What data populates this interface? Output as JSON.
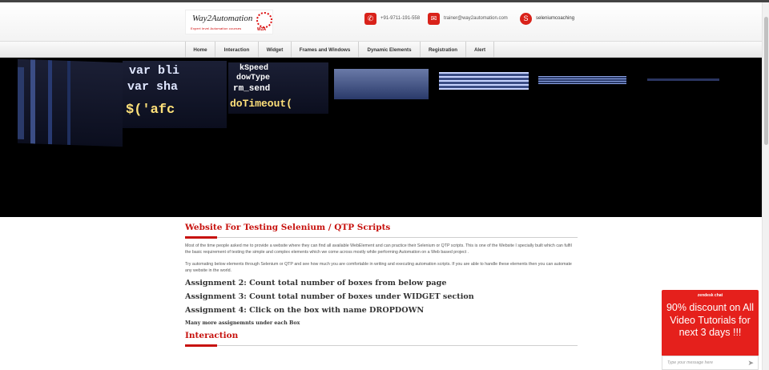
{
  "logo": {
    "name": "Way2Automation",
    "tagline": "Expert level Automation courses",
    "mark": "W2A"
  },
  "contacts": [
    {
      "icon": "phone-icon",
      "glyph": "✆",
      "text": "+91-9711-191-558"
    },
    {
      "icon": "mail-icon",
      "glyph": "✉",
      "text": "trainer@way2automation.com"
    },
    {
      "icon": "skype-icon",
      "glyph": "S",
      "text": "seleniumcoaching"
    }
  ],
  "nav": [
    "Home",
    "Interaction",
    "Widget",
    "Frames and Windows",
    "Dynamic Elements",
    "Registration",
    "Alert"
  ],
  "banner_code": [
    "var bli",
    "var sha",
    "$('afc",
    "kSpeed",
    "dowType",
    "rm_send",
    "doTimeout("
  ],
  "content": {
    "title": "Website For Testing Selenium / QTP Scripts",
    "para1": "Most of the time people asked me to provide a website where they can find all available WebElement and can practice their Selenium or QTP scripts. This is one of the Website I specially built which can fulfil the basic requirement of testing the simple and complex elements which we come across mostly while performing Automation on a Web based project .",
    "para2": "Try automating below elements through Selenium or QTP and see how much you are comfortable in writing and executing automation scripts. If you are able to handle these elements then you can automate any website in the world.",
    "assignments": [
      "Assignment 2: Count total number of boxes from below page",
      "Assignment 3: Count total number of boxes under WIDGET section",
      "Assignment 4: Click on the box with name DROPDOWN"
    ],
    "more": "Many more assignemnts under each Box",
    "section2": "Interaction"
  },
  "zendesk": {
    "header": "zendesk chat",
    "message": "90% discount on All Video Tutorials for next 3 days !!!",
    "placeholder": "Type your message here"
  },
  "colors": {
    "accent": "#c7120e",
    "widget": "#e5201c"
  }
}
